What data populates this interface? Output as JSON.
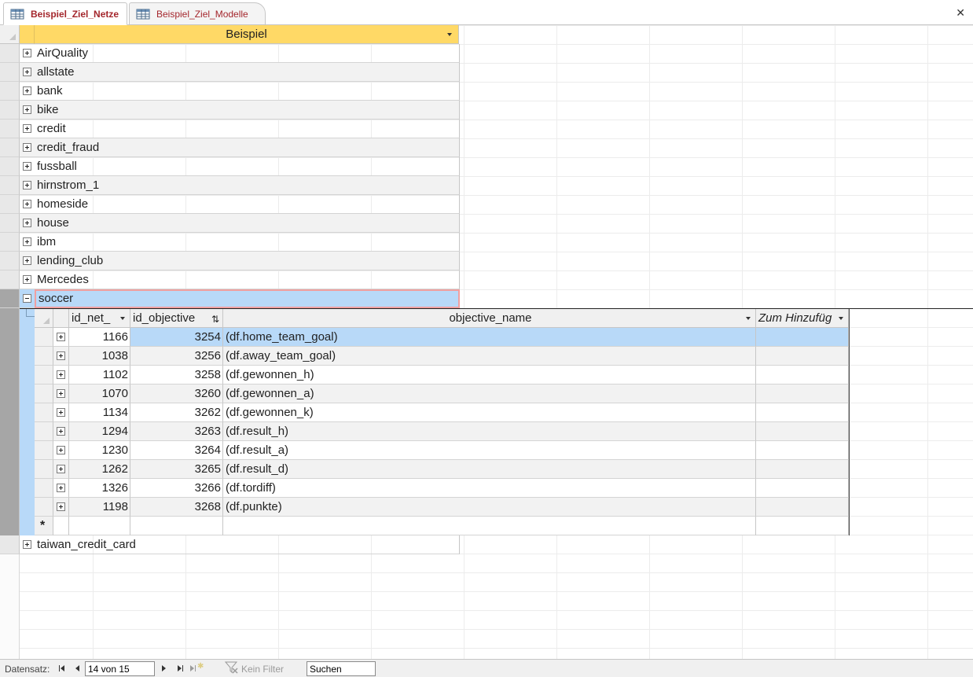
{
  "tabs": [
    {
      "label": "Beispiel_Ziel_Netze",
      "active": true
    },
    {
      "label": "Beispiel_Ziel_Modelle",
      "active": false
    }
  ],
  "main": {
    "column_header": "Beispiel",
    "rows": [
      "AirQuality",
      "allstate",
      "bank",
      "bike",
      "credit",
      "credit_fraud",
      "fussball",
      "hirnstrom_1",
      "homeside",
      "house",
      "ibm",
      "lending_club",
      "Mercedes",
      "soccer"
    ],
    "current_row": "soccer",
    "after_rows": [
      "taiwan_credit_card"
    ]
  },
  "sub": {
    "headers": {
      "id_net": "id_net_",
      "id_objective": "id_objective",
      "objective_name": "objective_name",
      "add": "Zum Hinzufüg"
    },
    "rows": [
      {
        "id_net": "1166",
        "id_objective": "3254",
        "objective_name": "(df.home_team_goal)"
      },
      {
        "id_net": "1038",
        "id_objective": "3256",
        "objective_name": "(df.away_team_goal)"
      },
      {
        "id_net": "1102",
        "id_objective": "3258",
        "objective_name": "(df.gewonnen_h)"
      },
      {
        "id_net": "1070",
        "id_objective": "3260",
        "objective_name": "(df.gewonnen_a)"
      },
      {
        "id_net": "1134",
        "id_objective": "3262",
        "objective_name": "(df.gewonnen_k)"
      },
      {
        "id_net": "1294",
        "id_objective": "3263",
        "objective_name": "(df.result_h)"
      },
      {
        "id_net": "1230",
        "id_objective": "3264",
        "objective_name": "(df.result_a)"
      },
      {
        "id_net": "1262",
        "id_objective": "3265",
        "objective_name": "(df.result_d)"
      },
      {
        "id_net": "1326",
        "id_objective": "3266",
        "objective_name": "(df.tordiff)"
      },
      {
        "id_net": "1198",
        "id_objective": "3268",
        "objective_name": "(df.punkte)"
      }
    ],
    "new_row_marker": "*"
  },
  "status": {
    "label": "Datensatz:",
    "record": "14 von 15",
    "filter": "Kein Filter",
    "search_value": "Suchen"
  },
  "colors": {
    "header_accent": "#ffd966",
    "selection_blue": "#b8d9f8",
    "tab_text": "#a4262c"
  },
  "icons": [
    "table-icon",
    "close-icon",
    "expand-plus-icon",
    "collapse-minus-icon",
    "dropdown-arrow-icon",
    "sort-filter-icon",
    "new-record-icon",
    "nav-first-icon",
    "nav-prev-icon",
    "nav-next-icon",
    "nav-last-icon",
    "nav-new-icon",
    "no-filter-icon"
  ]
}
